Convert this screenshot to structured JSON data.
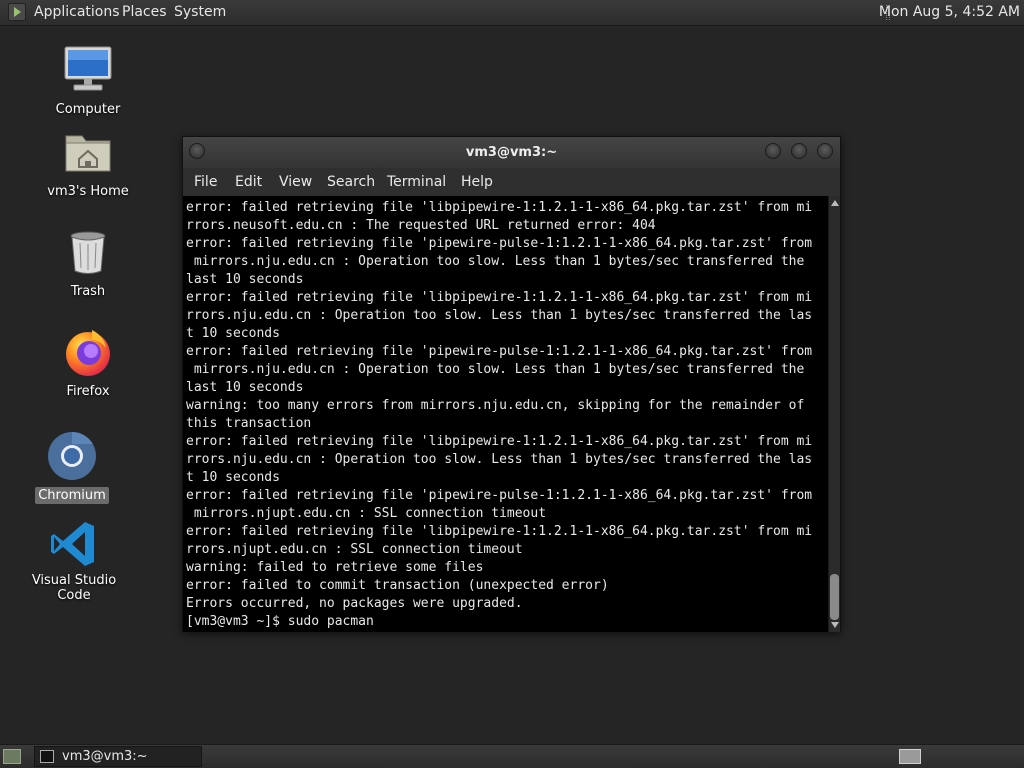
{
  "top_panel": {
    "menus": [
      "Applications",
      "Places",
      "System"
    ],
    "clock": "Mon Aug  5, 4:52 AM"
  },
  "desktop_icons": [
    {
      "label": "Computer",
      "icon": "computer-icon"
    },
    {
      "label": "vm3's Home",
      "icon": "home-folder-icon"
    },
    {
      "label": "Trash",
      "icon": "trash-icon"
    },
    {
      "label": "Firefox",
      "icon": "firefox-icon"
    },
    {
      "label": "Chromium",
      "icon": "chromium-icon",
      "selected": true
    },
    {
      "label": "Visual Studio Code",
      "icon": "vscode-icon"
    }
  ],
  "window": {
    "title": "vm3@vm3:~",
    "menu": [
      "File",
      "Edit",
      "View",
      "Search",
      "Terminal",
      "Help"
    ]
  },
  "terminal": {
    "lines": [
      "error: failed retrieving file 'libpipewire-1:1.2.1-1-x86_64.pkg.tar.zst' from mi",
      "rrors.neusoft.edu.cn : The requested URL returned error: 404",
      "error: failed retrieving file 'pipewire-pulse-1:1.2.1-1-x86_64.pkg.tar.zst' from",
      " mirrors.nju.edu.cn : Operation too slow. Less than 1 bytes/sec transferred the",
      "last 10 seconds",
      "error: failed retrieving file 'libpipewire-1:1.2.1-1-x86_64.pkg.tar.zst' from mi",
      "rrors.nju.edu.cn : Operation too slow. Less than 1 bytes/sec transferred the las",
      "t 10 seconds",
      "error: failed retrieving file 'pipewire-pulse-1:1.2.1-1-x86_64.pkg.tar.zst' from",
      " mirrors.nju.edu.cn : Operation too slow. Less than 1 bytes/sec transferred the",
      "last 10 seconds",
      "warning: too many errors from mirrors.nju.edu.cn, skipping for the remainder of",
      "this transaction",
      "error: failed retrieving file 'libpipewire-1:1.2.1-1-x86_64.pkg.tar.zst' from mi",
      "rrors.nju.edu.cn : Operation too slow. Less than 1 bytes/sec transferred the las",
      "t 10 seconds",
      "error: failed retrieving file 'pipewire-pulse-1:1.2.1-1-x86_64.pkg.tar.zst' from",
      " mirrors.njupt.edu.cn : SSL connection timeout",
      "error: failed retrieving file 'libpipewire-1:1.2.1-1-x86_64.pkg.tar.zst' from mi",
      "rrors.njupt.edu.cn : SSL connection timeout",
      "warning: failed to retrieve some files",
      "error: failed to commit transaction (unexpected error)",
      "Errors occurred, no packages were upgraded.",
      "[vm3@vm3 ~]$ sudo pacman"
    ]
  },
  "taskbar": {
    "tasks": [
      {
        "label": "vm3@vm3:~",
        "icon": "terminal-icon"
      }
    ]
  }
}
